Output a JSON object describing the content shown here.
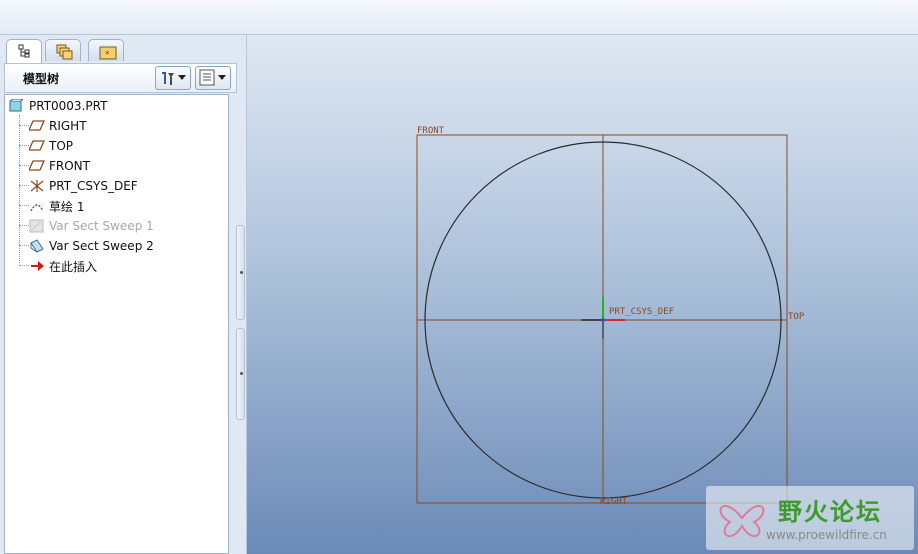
{
  "toolbar_message": "",
  "tabs": [
    {
      "icon": "model-tree-tab-icon"
    },
    {
      "icon": "layers-tab-icon"
    },
    {
      "icon": "favorites-folder-tab-icon"
    }
  ],
  "panel": {
    "title": "模型树",
    "settings_icon": "tree-settings-icon",
    "columns_icon": "tree-columns-icon"
  },
  "tree": {
    "root": "PRT0003.PRT",
    "items": [
      {
        "label": "RIGHT",
        "icon": "datum-plane-icon",
        "disabled": false
      },
      {
        "label": "TOP",
        "icon": "datum-plane-icon",
        "disabled": false
      },
      {
        "label": "FRONT",
        "icon": "datum-plane-icon",
        "disabled": false
      },
      {
        "label": "PRT_CSYS_DEF",
        "icon": "coordinate-system-icon",
        "disabled": false
      },
      {
        "label": "草绘 1",
        "icon": "sketch-icon",
        "disabled": false
      },
      {
        "label": "Var Sect Sweep 1",
        "icon": "var-sect-sweep-icon",
        "disabled": true
      },
      {
        "label": "Var Sect Sweep 2",
        "icon": "var-sect-sweep-icon",
        "disabled": false
      },
      {
        "label": "在此插入",
        "icon": "insert-here-arrow-icon",
        "disabled": false
      }
    ]
  },
  "viewport": {
    "labels": {
      "front": "FRONT",
      "top": "TOP",
      "right": "RIGHT",
      "csys": "PRT_CSYS_DEF"
    },
    "colors": {
      "datum": "#8a4a1c",
      "sketch": "#2b2b2b"
    }
  },
  "watermark": {
    "title": "野火论坛",
    "url": "www.proewildfire.cn"
  }
}
